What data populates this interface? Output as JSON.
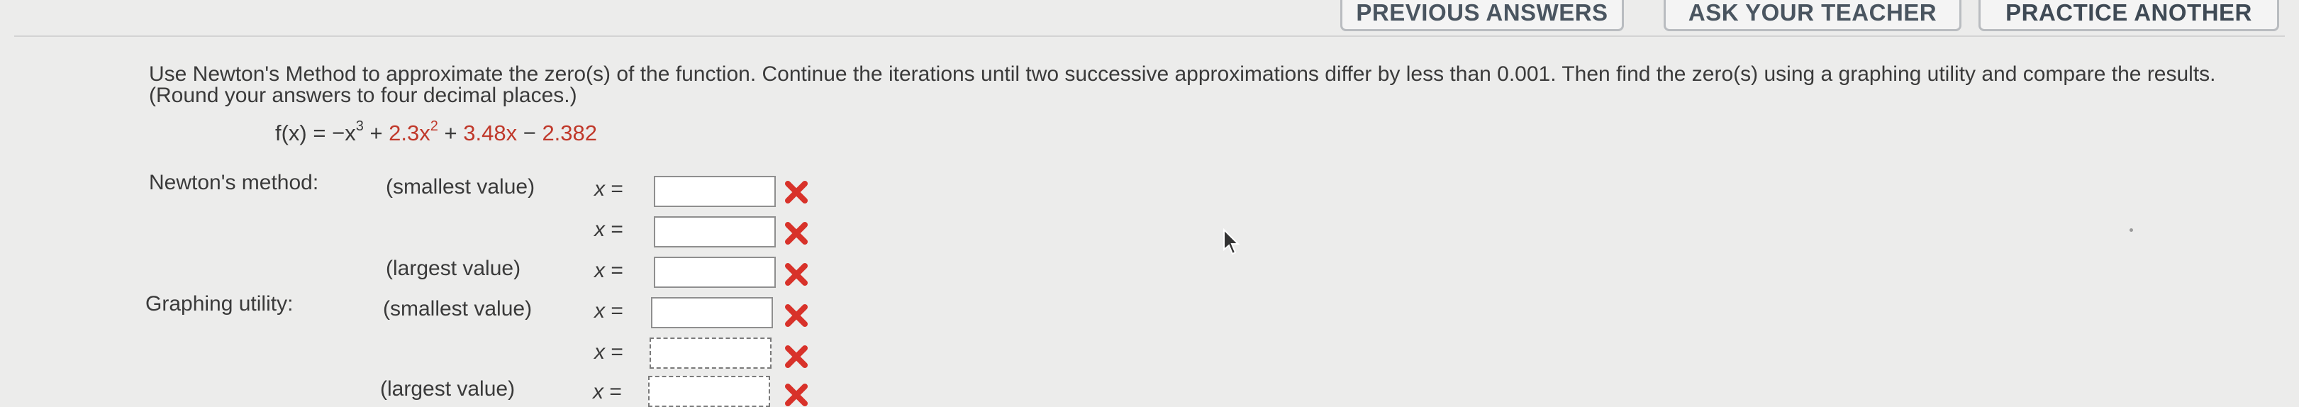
{
  "top_buttons": {
    "previous_answers": "PREVIOUS ANSWERS",
    "ask_teacher": "ASK YOUR TEACHER",
    "practice_another": "PRACTICE ANOTHER"
  },
  "problem": {
    "prompt": "Use Newton's Method to approximate the zero(s) of the function. Continue the iterations until two successive approximations differ by less than 0.001. Then find the zero(s) using a graphing utility and compare the results. (Round your answers to four decimal places.)",
    "formula": {
      "lhs": "f(x) = ",
      "t1": "−x",
      "t1_exp": "3",
      "op1": " + ",
      "t2": "2.3x",
      "t2_exp": "2",
      "op2": " + ",
      "t3": "3.48x",
      "op3": " − ",
      "t4": "2.382"
    }
  },
  "newtons_method": {
    "label": "Newton's method:",
    "rows": [
      {
        "qualifier": "(smallest value)",
        "var": "x",
        "eq": "=",
        "value": "",
        "status": "incorrect"
      },
      {
        "qualifier": "",
        "var": "x",
        "eq": "=",
        "value": "",
        "status": "incorrect"
      },
      {
        "qualifier": "(largest value)",
        "var": "x",
        "eq": "=",
        "value": "",
        "status": "incorrect"
      }
    ]
  },
  "graphing_utility": {
    "label": "Graphing utility:",
    "rows": [
      {
        "qualifier": "(smallest value)",
        "var": "x",
        "eq": "=",
        "value": "",
        "status": "incorrect"
      },
      {
        "qualifier": "",
        "var": "x",
        "eq": "=",
        "value": "",
        "status": "incorrect"
      },
      {
        "qualifier": "(largest value)",
        "var": "x",
        "eq": "=",
        "value": "",
        "status": "incorrect"
      }
    ]
  },
  "colors": {
    "incorrect_mark": "#d8322a",
    "formula_red": "#c0392b"
  }
}
